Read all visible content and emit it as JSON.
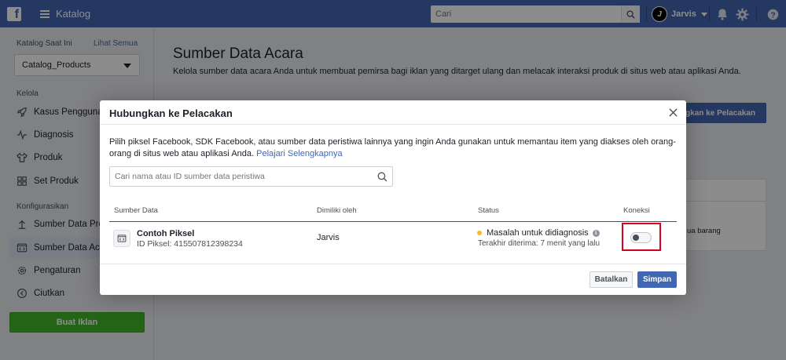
{
  "topbar": {
    "logo": "f",
    "app_title": "Katalog",
    "search_placeholder": "Cari",
    "user_name": "Jarvis",
    "user_initial": "J",
    "icons": [
      "menu-icon",
      "search-icon",
      "notifications-icon",
      "settings-icon",
      "help-icon"
    ]
  },
  "sidebar": {
    "catalog_label": "Katalog Saat Ini",
    "see_all": "Lihat Semua",
    "catalog_selected": "Catalog_Products",
    "section_manage": "Kelola",
    "section_config": "Konfigurasikan",
    "items": [
      {
        "label": "Kasus Penggunaan",
        "icon": "rocket-icon"
      },
      {
        "label": "Diagnosis",
        "icon": "pulse-icon"
      },
      {
        "label": "Produk",
        "icon": "shirt-icon"
      },
      {
        "label": "Set Produk",
        "icon": "grid-icon"
      },
      {
        "label": "Sumber Data Produk",
        "icon": "upload-icon"
      },
      {
        "label": "Sumber Data Acara",
        "icon": "code-window-icon"
      },
      {
        "label": "Pengaturan",
        "icon": "gear-icon"
      },
      {
        "label": "Ciutkan",
        "icon": "collapse-icon"
      }
    ],
    "create_ad": "Buat Iklan"
  },
  "main": {
    "title": "Sumber Data Acara",
    "description": "Kelola sumber data acara Anda untuk membuat pemirsa bagi iklan yang ditarget ulang dan melacak interaksi produk di situs web atau aplikasi Anda.",
    "connect_button": "ungkan ke Pelacakan",
    "partial_text": "ua barang"
  },
  "modal": {
    "title": "Hubungkan ke Pelacakan",
    "description": "Pilih piksel Facebook, SDK Facebook, atau sumber data peristiwa lainnya yang ingin Anda gunakan untuk memantau item yang diakses oleh orang-orang di situs web atau aplikasi Anda.",
    "learn_more": "Pelajari Selengkapnya",
    "search_placeholder": "Cari nama atau ID sumber data peristiwa",
    "columns": {
      "source": "Sumber Data",
      "owner": "Dimiliki oleh",
      "status": "Status",
      "connection": "Koneksi"
    },
    "row": {
      "name": "Contoh Piksel",
      "id": "ID Piksel: 415507812398234",
      "owner": "Jarvis",
      "status": "Masalah untuk didiagnosis",
      "status_sub": "Terakhir diterima: 7 menit yang lalu",
      "status_color": "#f7b928",
      "connected": false
    },
    "cancel": "Batalkan",
    "save": "Simpan"
  },
  "colors": {
    "brand": "#4267b2",
    "create_ad": "#42b72a",
    "highlight": "#d0021b"
  }
}
